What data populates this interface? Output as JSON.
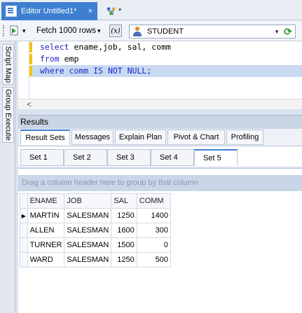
{
  "tabs": [
    {
      "label": "Editor Untitled1*",
      "close": "×"
    },
    {
      "label": "*"
    }
  ],
  "toolbar": {
    "fetch_label": "Fetch 1000 rows",
    "fetch_arrow": "▾",
    "exec_arrow": "▾",
    "x_button": "(x)",
    "connection": "STUDENT",
    "connection_arrow": "▼",
    "refresh": "⟳"
  },
  "sidebar": {
    "tabs": [
      "Script Map",
      "Group Execute"
    ]
  },
  "editor": {
    "lines": [
      {
        "pre": "select ",
        "kw": "",
        "text": "ename,job, sal, comm"
      },
      {
        "pre": "from ",
        "kw": "",
        "text": "emp"
      },
      {
        "pre": "where comm ",
        "kw": "IS NOT NULL",
        "text": ";"
      }
    ],
    "scroll_left": "<"
  },
  "results": {
    "header": "Results",
    "tabs": [
      "Result Sets",
      "Messages",
      "Explain Plan",
      "Pivot & Chart",
      "Profiling"
    ],
    "active_tab": "Result Sets",
    "sets": [
      "Set 1",
      "Set 2",
      "Set 3",
      "Set 4",
      "Set 5"
    ],
    "active_set": "Set 5",
    "group_placeholder": "Drag a column header here to group by that column",
    "columns": [
      "ENAME",
      "JOB",
      "SAL",
      "COMM"
    ],
    "rows": [
      [
        "MARTIN",
        "SALESMAN",
        "1250",
        "1400"
      ],
      [
        "ALLEN",
        "SALESMAN",
        "1600",
        "300"
      ],
      [
        "TURNER",
        "SALESMAN",
        "1500",
        "0"
      ],
      [
        "WARD",
        "SALESMAN",
        "1250",
        "500"
      ]
    ],
    "current_row_marker": "▶"
  },
  "colors": {
    "accent": "#3d7fd0",
    "keyword": "#1f25c8",
    "highlight": "#c9d9f2"
  }
}
